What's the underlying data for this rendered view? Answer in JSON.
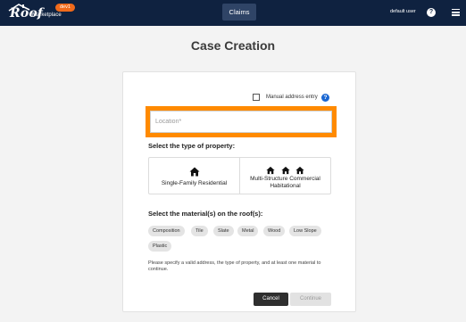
{
  "header": {
    "logo_main": "Roof",
    "logo_sub": "Marketplace",
    "env_badge": "dev1",
    "nav_claims": "Claims",
    "user_name": "default user",
    "help_glyph": "?",
    "menu_icon": "hamburger-menu-icon"
  },
  "page": {
    "title": "Case Creation"
  },
  "form": {
    "manual_address_label": "Manual address entry",
    "manual_address_checked": false,
    "location_placeholder": "Location*",
    "location_value": "",
    "property_section_label": "Select the type of property:",
    "property_options": [
      {
        "label": "Single-Family Residential",
        "icon": "house-icon"
      },
      {
        "label": "Multi-Structure Commercial Habitational",
        "icon": "three-houses-icon"
      }
    ],
    "materials_section_label": "Select the material(s) on the roof(s):",
    "materials": [
      "Composition",
      "Tile",
      "Slate",
      "Metal",
      "Wood",
      "Low Slope",
      "Plastic"
    ],
    "hint": "Please specify a valid address, the type of property, and at least one material to continue.",
    "cancel_label": "Cancel",
    "continue_label": "Continue",
    "continue_enabled": false
  },
  "colors": {
    "header_bg": "#0f2240",
    "highlight": "#ff8a00",
    "env_badge": "#f06a1b",
    "help_blue": "#1a67d2"
  }
}
